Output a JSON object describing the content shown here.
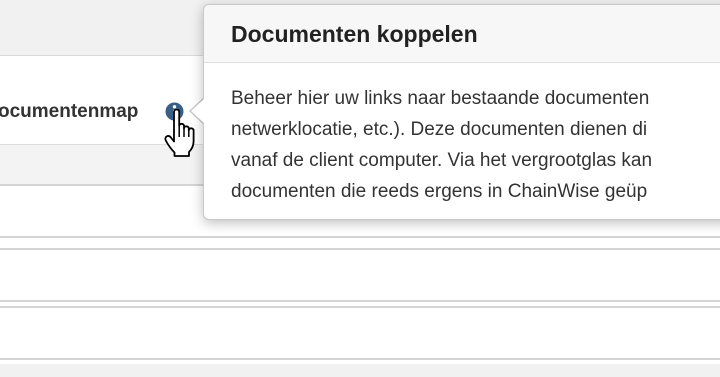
{
  "form": {
    "field_label": "ocumentenmap",
    "info_icon": "info-circle-icon",
    "cursor_icon": "hand-pointer-cursor-icon"
  },
  "tooltip": {
    "title": "Documenten koppelen",
    "body_lines": [
      "Beheer hier uw links naar bestaande documenten",
      "netwerklocatie, etc.). Deze documenten dienen di",
      "vanaf de client computer. Via het vergrootglas kan",
      "documenten die reeds ergens in ChainWise geüp"
    ]
  },
  "colors": {
    "info_icon": "#3a5f86",
    "label_text": "#333333",
    "tooltip_border": "#c9c9c9",
    "tooltip_header_bg": "#f7f7f7"
  }
}
